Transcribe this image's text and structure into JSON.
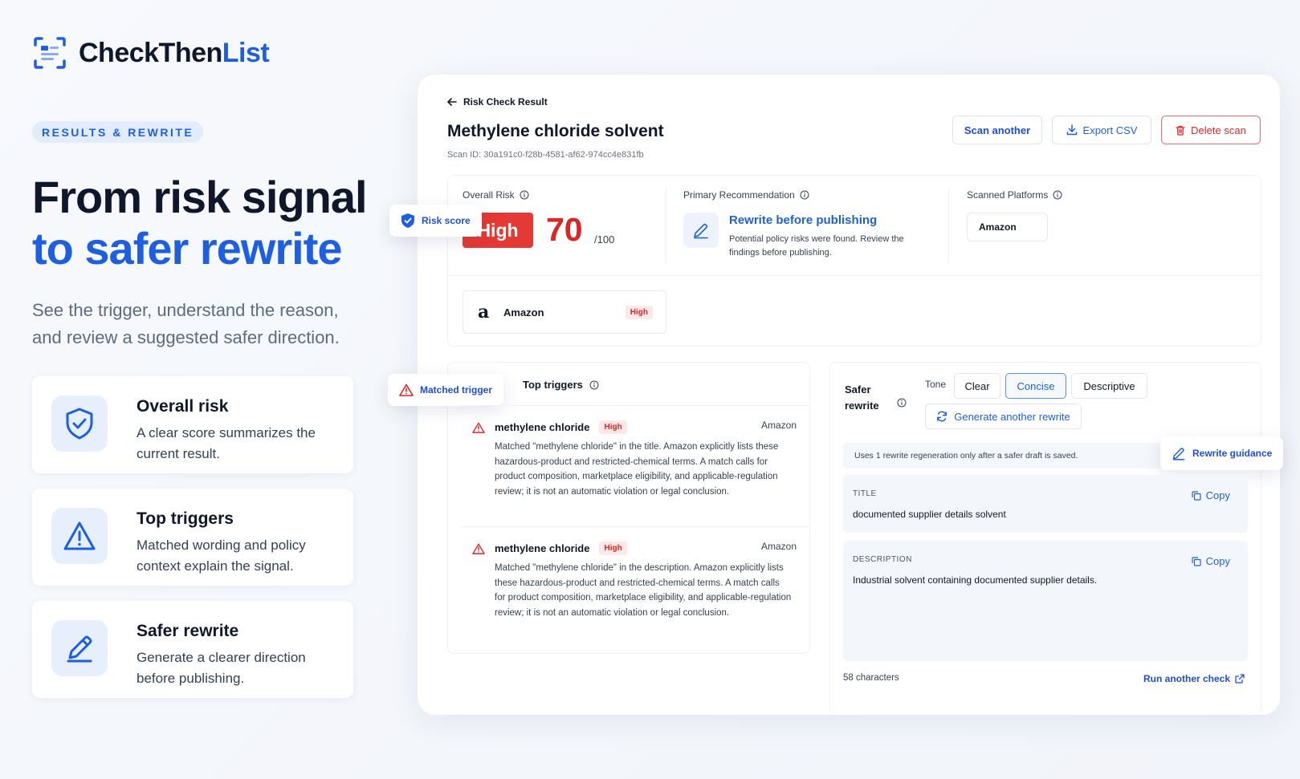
{
  "brand": {
    "name_part1": "CheckThen",
    "name_part2": "List"
  },
  "marketing": {
    "eyebrow": "RESULTS & REWRITE",
    "headline_line1": "From risk signal",
    "headline_line2": "to safer rewrite",
    "subhead": "See the trigger, understand the reason, and review a suggested safer direction.",
    "features": [
      {
        "title": "Overall risk",
        "desc": "A clear score summarizes the current result.",
        "icon": "shield-check-icon"
      },
      {
        "title": "Top triggers",
        "desc": "Matched wording and policy context explain the signal.",
        "icon": "warning-triangle-icon"
      },
      {
        "title": "Safer rewrite",
        "desc": "Generate a clearer direction before publishing.",
        "icon": "pencil-edit-icon"
      }
    ]
  },
  "header": {
    "back_label": "Risk Check Result",
    "title": "Methylene chloride solvent",
    "scan_id": "Scan ID: 30a191c0-f28b-4581-af62-974cc4e831fb",
    "buttons": {
      "scan_another": "Scan another",
      "export_csv": "Export CSV",
      "delete_scan": "Delete scan"
    }
  },
  "summary": {
    "overall_risk_label": "Overall Risk",
    "risk_level": "High",
    "risk_score": "70",
    "risk_max": "/100",
    "recommendation_label": "Primary Recommendation",
    "recommendation_title": "Rewrite before publishing",
    "recommendation_desc": "Potential policy risks were found. Review the findings before publishing.",
    "platforms_label": "Scanned Platforms",
    "platform_chip": "Amazon",
    "platform_row": {
      "logo_letter": "a",
      "name": "Amazon",
      "level": "High"
    }
  },
  "floating_tags": {
    "risk_score": "Risk score",
    "matched_trigger": "Matched trigger",
    "rewrite_guidance": "Rewrite guidance"
  },
  "triggers": {
    "heading": "Top triggers",
    "items": [
      {
        "term": "methylene chloride",
        "level": "High",
        "platform": "Amazon",
        "desc": "Matched \"methylene chloride\" in the title. Amazon explicitly lists these hazardous-product and restricted-chemical terms. A match calls for product composition, marketplace eligibility, and applicable-regulation review; it is not an automatic violation or legal conclusion."
      },
      {
        "term": "methylene chloride",
        "level": "High",
        "platform": "Amazon",
        "desc": "Matched \"methylene chloride\" in the description. Amazon explicitly lists these hazardous-product and restricted-chemical terms. A match calls for product composition, marketplace eligibility, and applicable-regulation review; it is not an automatic violation or legal conclusion."
      }
    ]
  },
  "rewrite": {
    "label": "Safer rewrite",
    "tone_label": "Tone",
    "tones": [
      "Clear",
      "Concise",
      "Descriptive"
    ],
    "active_tone": "Concise",
    "regen_label": "Generate another rewrite",
    "notice": "Uses 1 rewrite regeneration only after a safer draft is saved.",
    "title_label": "TITLE",
    "title_value": "documented supplier details solvent",
    "description_label": "DESCRIPTION",
    "description_value": "Industrial solvent containing documented supplier details.",
    "copy_label": "Copy",
    "char_count": "58 characters",
    "run_another": "Run another check"
  },
  "colors": {
    "accent": "#1d5fe0",
    "danger": "#dc2626",
    "risk_pill": "#e53935"
  }
}
